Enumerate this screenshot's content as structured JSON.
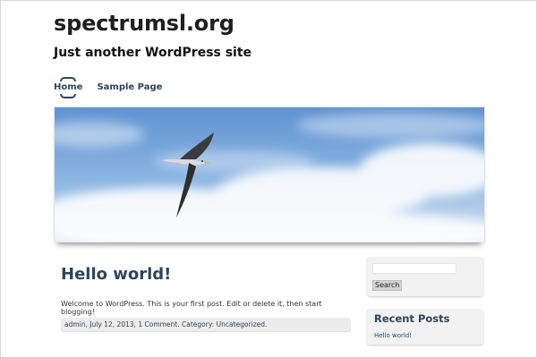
{
  "site": {
    "title": "spectrumsl.org",
    "tagline": "Just another WordPress site"
  },
  "nav": {
    "items": [
      {
        "label": "Home",
        "active": true
      },
      {
        "label": "Sample Page",
        "active": false
      }
    ]
  },
  "banner": {
    "image": "seagull-in-blue-sky-photo"
  },
  "post": {
    "title": "Hello world!",
    "content": "Welcome to WordPress. This is your first post. Edit or delete it, then start blogging!",
    "meta": {
      "author": "admin",
      "sep1": ", ",
      "date": "July 12, 2013",
      "sep2": ", ",
      "comments": "1 Comment",
      "sep3": ". Category: ",
      "category": "Uncategorized",
      "end": "."
    }
  },
  "sidebar": {
    "search": {
      "value": "",
      "button_label": "Search"
    },
    "recent_posts": {
      "title": "Recent Posts",
      "items": [
        "Hello world!"
      ]
    }
  },
  "colors": {
    "link": "#2e4459",
    "sky": "#7aa7d8"
  }
}
